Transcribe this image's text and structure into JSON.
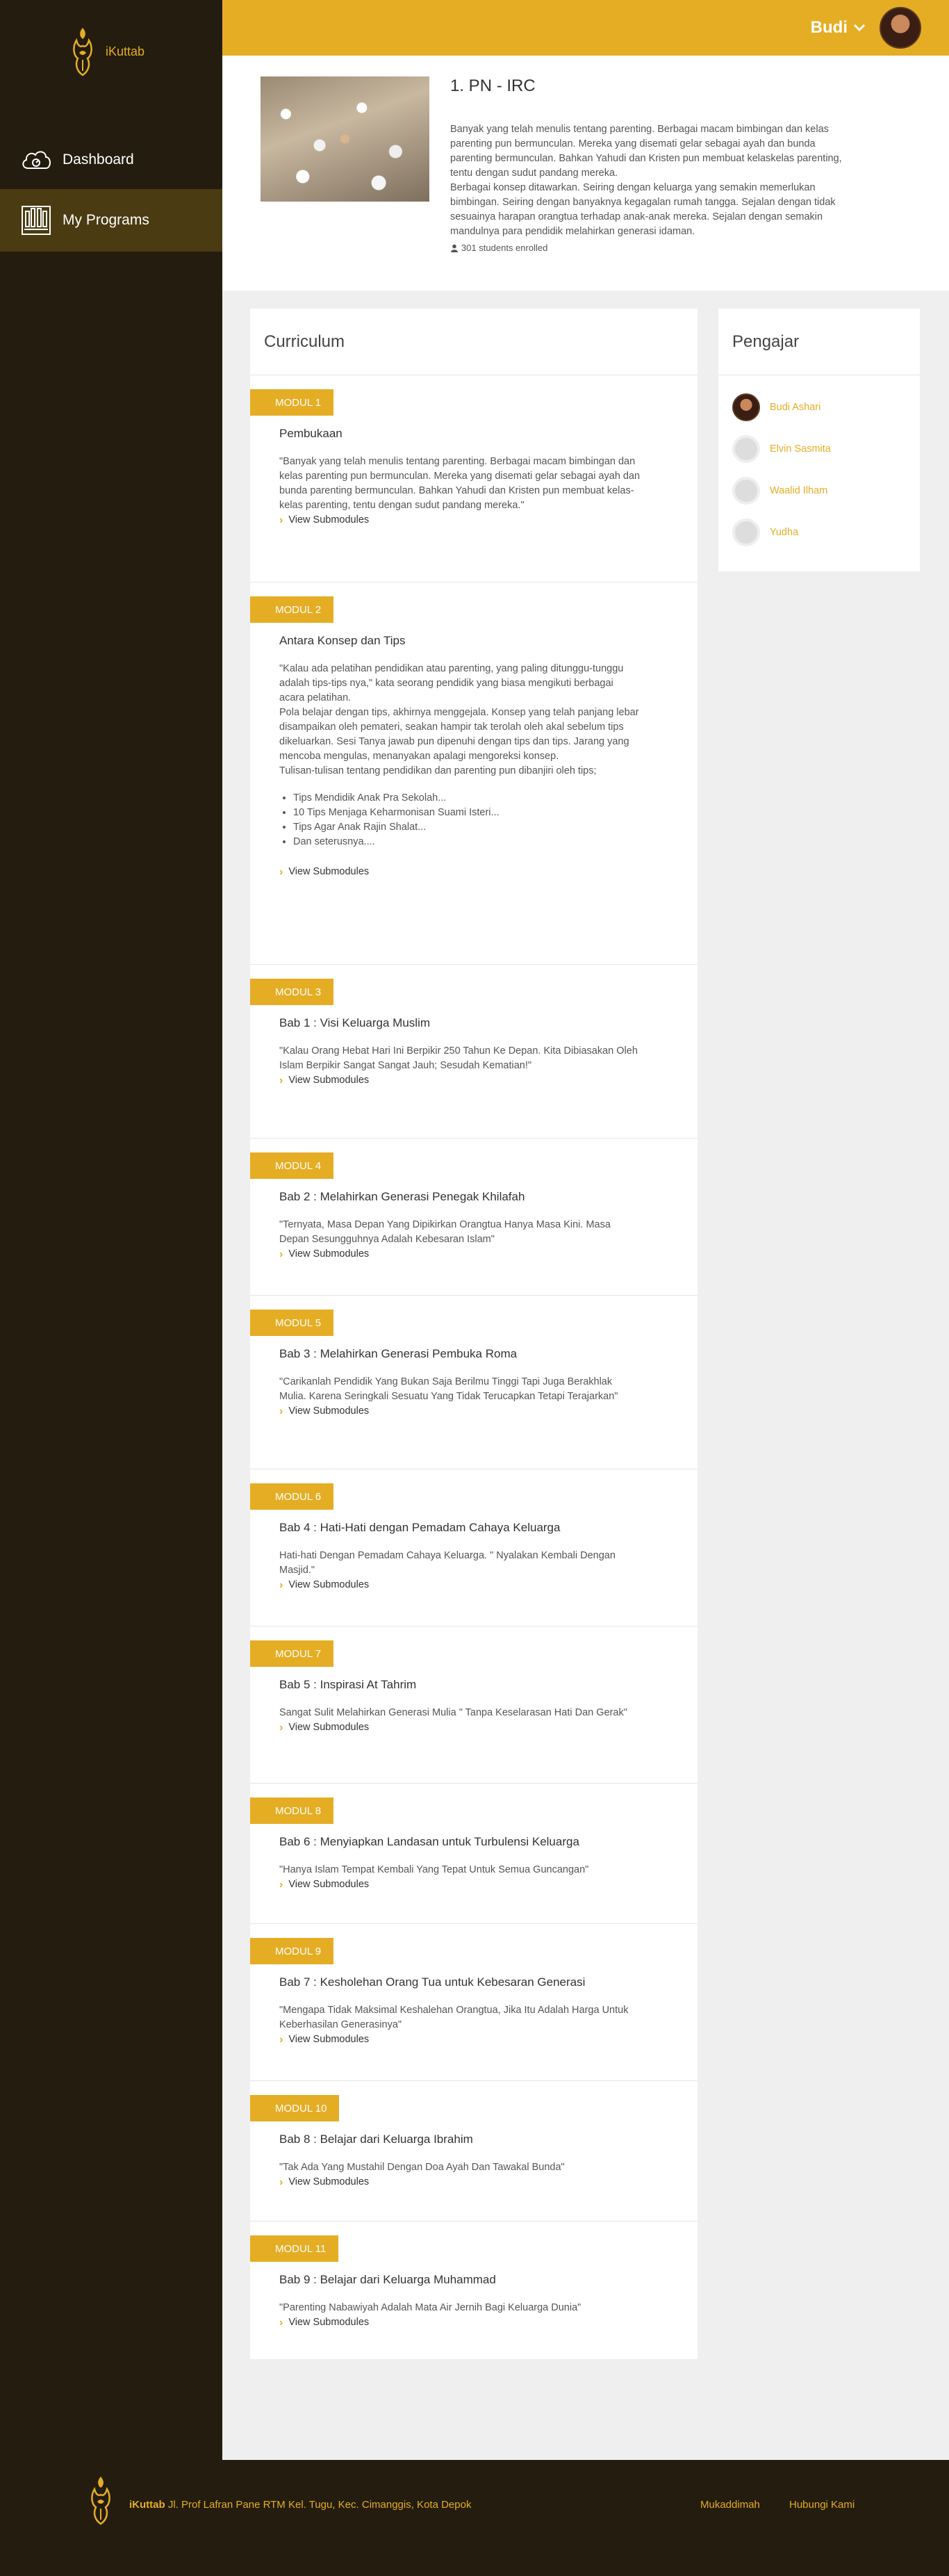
{
  "brand": {
    "name": "iKuttab"
  },
  "sidebar": {
    "items": [
      {
        "label": "Dashboard",
        "icon": "cloud-icon"
      },
      {
        "label": "My Programs",
        "icon": "organ-icon"
      }
    ]
  },
  "topbar": {
    "user_name": "Budi"
  },
  "program": {
    "title": "1. PN - IRC",
    "description": [
      "Banyak yang telah menulis tentang parenting. Berbagai macam bimbingan dan kelas parenting pun bermunculan. Mereka yang disemati gelar sebagai ayah dan bunda parenting bermunculan. Bahkan Yahudi dan Kristen pun membuat kelaskelas parenting, tentu dengan sudut pandang mereka.",
      "Berbagai konsep ditawarkan. Seiring dengan keluarga yang semakin memerlukan bimbingan. Seiring dengan banyaknya kegagalan rumah tangga. Sejalan dengan tidak sesuainya harapan orangtua terhadap anak-anak mereka. Sejalan dengan semakin mandulnya para pendidik melahirkan generasi idaman."
    ],
    "enrolled": "301 students enrolled"
  },
  "curriculum": {
    "title": "Curriculum",
    "view_label": "View Submodules",
    "modules": [
      {
        "badge": "MODUL 1",
        "title": "Pembukaan",
        "desc": "\"Banyak yang telah menulis tentang parenting. Berbagai macam bimbingan dan kelas parenting pun bermunculan. Mereka yang disemati gelar sebagai ayah dan bunda parenting bermunculan. Bahkan Yahudi dan Kristen pun membuat kelas-kelas parenting, tentu dengan sudut pandang mereka.\""
      },
      {
        "badge": "MODUL 2",
        "title": "Antara Konsep dan Tips",
        "desc_lines": [
          "\"Kalau ada pelatihan pendidikan atau parenting, yang paling ditunggu-tunggu adalah tips-tips nya,\" kata seorang pendidik yang biasa mengikuti berbagai acara pelatihan.",
          "Pola belajar dengan tips, akhirnya menggejala. Konsep yang telah panjang lebar disampaikan oleh pemateri, seakan hampir tak terolah oleh akal sebelum tips dikeluarkan. Sesi Tanya jawab pun dipenuhi dengan tips dan tips. Jarang yang mencoba mengulas, menanyakan apalagi mengoreksi konsep.",
          "Tulisan-tulisan tentang pendidikan dan parenting pun dibanjiri oleh tips;"
        ],
        "bullets": [
          "Tips Mendidik Anak Pra Sekolah...",
          "10 Tips Menjaga Keharmonisan Suami Isteri...",
          "Tips Agar Anak Rajin Shalat...",
          "Dan seterusnya...."
        ]
      },
      {
        "badge": "MODUL 3",
        "title": "Bab 1 : Visi Keluarga Muslim",
        "desc": "\"Kalau Orang Hebat Hari Ini Berpikir 250 Tahun Ke Depan. Kita Dibiasakan Oleh Islam Berpikir Sangat Sangat Jauh; Sesudah Kematian!\""
      },
      {
        "badge": "MODUL 4",
        "title": "Bab 2 : Melahirkan Generasi Penegak Khilafah",
        "desc": "\"Ternyata, Masa Depan Yang Dipikirkan Orangtua Hanya Masa Kini. Masa Depan Sesungguhnya Adalah Kebesaran Islam\""
      },
      {
        "badge": "MODUL 5",
        "title": "Bab 3 : Melahirkan Generasi Pembuka Roma",
        "desc": "\"Carikanlah Pendidik Yang Bukan Saja Berilmu Tinggi Tapi Juga Berakhlak Mulia. Karena Seringkali Sesuatu Yang Tidak Terucapkan Tetapi Terajarkan\""
      },
      {
        "badge": "MODUL 6",
        "title": "Bab 4 : Hati-Hati dengan Pemadam Cahaya Keluarga",
        "desc": "Hati-hati Dengan Pemadam Cahaya Keluarga. \" Nyalakan Kembali Dengan Masjid.\""
      },
      {
        "badge": "MODUL 7",
        "title": "Bab 5 : Inspirasi At Tahrim",
        "desc": "Sangat Sulit Melahirkan Generasi Mulia \" Tanpa Keselarasan Hati Dan Gerak\""
      },
      {
        "badge": "MODUL 8",
        "title": "Bab 6 : Menyiapkan Landasan untuk Turbulensi Keluarga",
        "desc": "\"Hanya Islam Tempat Kembali Yang Tepat Untuk Semua Guncangan\""
      },
      {
        "badge": "MODUL 9",
        "title": "Bab 7 : Kesholehan Orang Tua untuk Kebesaran Generasi",
        "desc": "\"Mengapa Tidak Maksimal Keshalehan Orangtua, Jika Itu Adalah Harga Untuk Keberhasilan Generasinya\""
      },
      {
        "badge": "MODUL 10",
        "title": "Bab 8 : Belajar dari Keluarga Ibrahim",
        "desc": "\"Tak Ada Yang Mustahil Dengan Doa Ayah Dan Tawakal Bunda\""
      },
      {
        "badge": "MODUL 11",
        "title": "Bab 9 : Belajar dari Keluarga Muhammad",
        "desc": "\"Parenting Nabawiyah Adalah Mata Air Jernih Bagi Keluarga Dunia\""
      }
    ]
  },
  "pengajar": {
    "title": "Pengajar",
    "teachers": [
      "Budi Ashari",
      "Elvin Sasmita",
      "Waalid Ilham",
      "Yudha"
    ]
  },
  "footer": {
    "brand": "iKuttab",
    "address": " Jl. Prof Lafran Pane RTM Kel. Tugu, Kec. Cimanggis, Kota Depok",
    "links": [
      "Mukaddimah",
      "Hubungi Kami"
    ]
  },
  "colors": {
    "accent": "#e5ad24",
    "dark": "#231c0f",
    "active_nav": "#4b3b12"
  }
}
